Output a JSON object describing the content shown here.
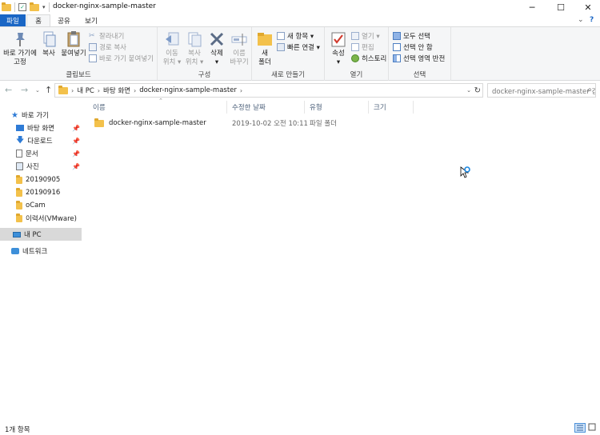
{
  "window": {
    "title": "docker-nginx-sample-master",
    "minimize": "─",
    "maximize": "☐",
    "close": "✕"
  },
  "tabs": {
    "file": "파일",
    "home": "홈",
    "share": "공유",
    "view": "보기"
  },
  "ribbon": {
    "clipboard": {
      "pin": "바로 가기에\n고정",
      "copy": "복사",
      "paste": "붙여넣기",
      "cut": "잘라내기",
      "copy_path": "경로 복사",
      "paste_shortcut": "바로 가기 붙여넣기",
      "label": "클립보드"
    },
    "organize": {
      "move_to": "이동\n위치 ▾",
      "copy_to": "복사\n위치 ▾",
      "delete": "삭제\n▾",
      "rename": "이름\n바꾸기",
      "label": "구성"
    },
    "new": {
      "new_folder": "새\n폴더",
      "new_item": "새 항목 ▾",
      "easy_access": "빠른 연결 ▾",
      "label": "새로 만들기"
    },
    "open": {
      "properties": "속성\n▾",
      "open": "열기 ▾",
      "edit": "편집",
      "history": "히스토리",
      "label": "열기"
    },
    "select": {
      "select_all": "모두 선택",
      "select_none": "선택 안 함",
      "invert": "선택 영역 반전",
      "label": "선택"
    }
  },
  "address": {
    "crumbs": [
      "내 PC",
      "바탕 화면",
      "docker-nginx-sample-master"
    ],
    "search_placeholder": "docker-nginx-sample-master 검색"
  },
  "nav": {
    "quick_access": "바로 가기",
    "items": [
      "바탕 화면",
      "다운로드",
      "문서",
      "사진",
      "20190905",
      "20190916",
      "oCam",
      "이력서(VMware)"
    ],
    "this_pc": "내 PC",
    "network": "네트워크"
  },
  "columns": {
    "name": "이름",
    "modified": "수정한 날짜",
    "type": "유형",
    "size": "크기"
  },
  "files": [
    {
      "name": "docker-nginx-sample-master",
      "modified": "2019-10-02 오전 10:11",
      "type": "파일 폴더",
      "size": ""
    }
  ],
  "status": {
    "count": "1개 항목"
  },
  "colors": {
    "accent": "#1a66c5",
    "folder": "#f3c14b",
    "selected": "#d9d9d9"
  }
}
